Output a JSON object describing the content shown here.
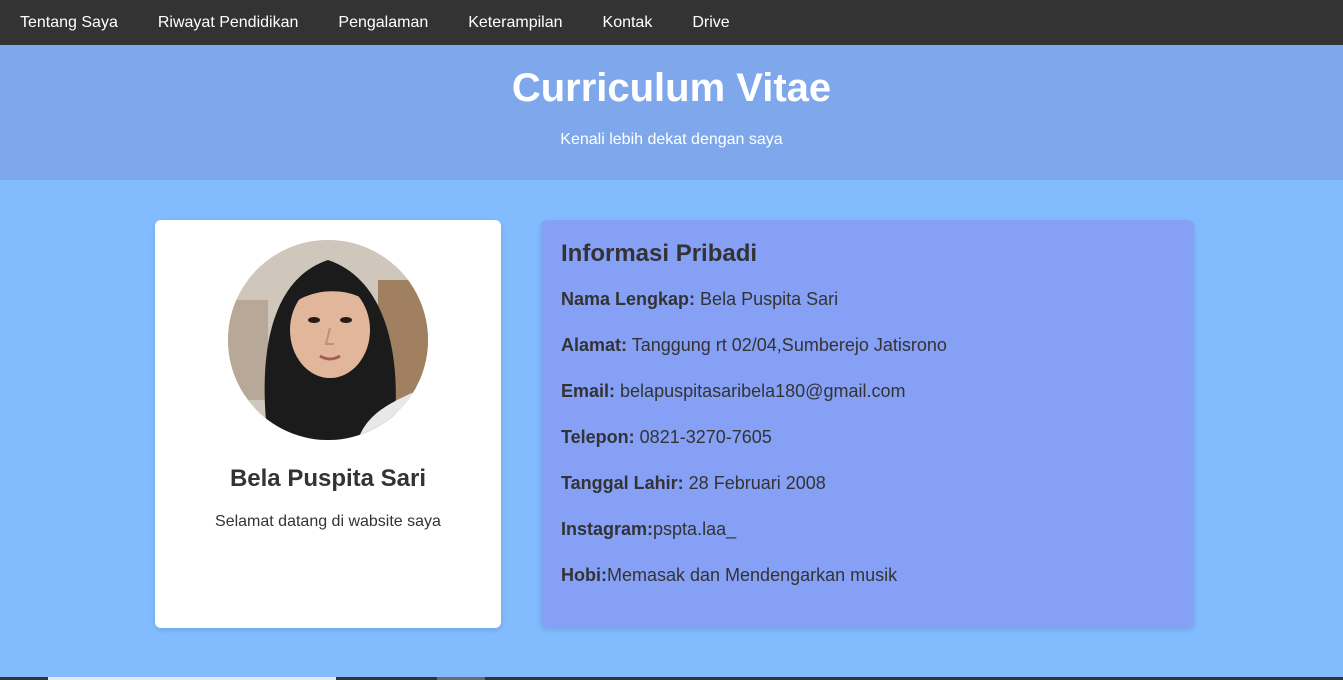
{
  "nav": {
    "items": [
      {
        "label": "Tentang Saya"
      },
      {
        "label": "Riwayat Pendidikan"
      },
      {
        "label": "Pengalaman"
      },
      {
        "label": "Keterampilan"
      },
      {
        "label": "Kontak"
      },
      {
        "label": "Drive"
      }
    ]
  },
  "hero": {
    "title": "Curriculum Vitae",
    "subtitle": "Kenali lebih dekat dengan saya"
  },
  "profile": {
    "name": "Bela Puspita Sari",
    "tagline": "Selamat datang di wabsite saya",
    "avatar_icon": "profile-photo"
  },
  "info": {
    "heading": "Informasi Pribadi",
    "rows": [
      {
        "label": "Nama Lengkap:",
        "value": " Bela Puspita Sari"
      },
      {
        "label": "Alamat:",
        "value": " Tanggung rt 02/04,Sumberejo Jatisrono"
      },
      {
        "label": "Email:",
        "value": " belapuspitasaribela180@gmail.com"
      },
      {
        "label": "Telepon:",
        "value": " 0821-3270-7605"
      },
      {
        "label": "Tanggal Lahir:",
        "value": " 28 Februari 2008"
      },
      {
        "label": "Instagram:",
        "value": "pspta.laa_"
      },
      {
        "label": "Hobi:",
        "value": "Memasak dan Mendengarkan musik"
      }
    ]
  },
  "colors": {
    "nav_bg": "#333333",
    "hero_bg": "#7fa8ec",
    "page_bg": "#82bcff",
    "info_card_bg": "#85a0f5"
  }
}
